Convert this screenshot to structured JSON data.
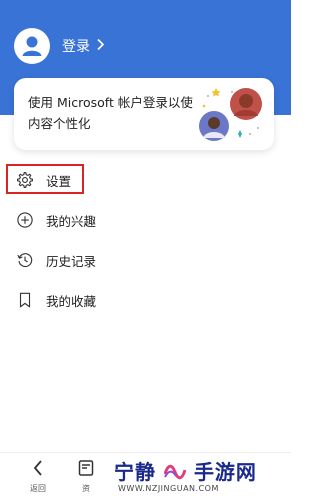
{
  "header": {
    "login_label": "登录",
    "accent_color": "#3a73d6"
  },
  "promo_card": {
    "text": "使用 Microsoft 帐户登录以使内容个性化"
  },
  "menu": {
    "items": [
      {
        "label": "设置",
        "icon": "gear-icon",
        "highlighted": true
      },
      {
        "label": "我的兴趣",
        "icon": "plus-circle-icon",
        "highlighted": false
      },
      {
        "label": "历史记录",
        "icon": "history-icon",
        "highlighted": false
      },
      {
        "label": "我的收藏",
        "icon": "bookmark-icon",
        "highlighted": false
      }
    ]
  },
  "bottom_nav": {
    "back_label": "返回",
    "res_label": "资"
  },
  "watermark": {
    "brand": "宁静",
    "brand2": "手游网",
    "url": "WWW.NZJINGUAN.COM",
    "brand_color": "#1a2a8c"
  }
}
